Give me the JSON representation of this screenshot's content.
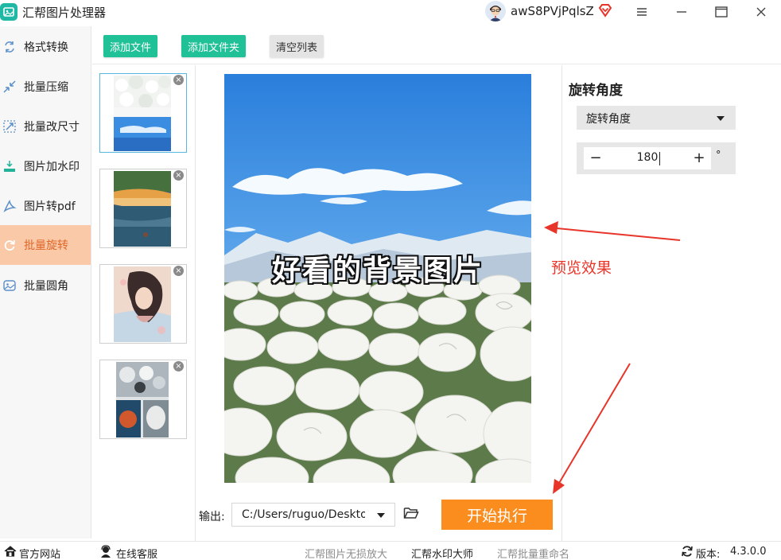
{
  "app": {
    "title": "汇帮图片处理器"
  },
  "user": {
    "name": "awS8PVjPqlsZ"
  },
  "sidebar": {
    "items": [
      {
        "label": "格式转换",
        "icon": "format-convert-icon",
        "active": false
      },
      {
        "label": "批量压缩",
        "icon": "compress-icon",
        "active": false
      },
      {
        "label": "批量改尺寸",
        "icon": "resize-icon",
        "active": false
      },
      {
        "label": "图片加水印",
        "icon": "watermark-icon",
        "active": false
      },
      {
        "label": "图片转pdf",
        "icon": "pdf-icon",
        "active": false
      },
      {
        "label": "批量旋转",
        "icon": "rotate-icon",
        "active": true
      },
      {
        "label": "批量圆角",
        "icon": "round-corner-icon",
        "active": false
      }
    ]
  },
  "toolbar": {
    "add_file": "添加文件",
    "add_folder": "添加文件夹",
    "clear_list": "清空列表"
  },
  "thumbnails": [
    {
      "selected": true
    },
    {
      "selected": false
    },
    {
      "selected": false
    },
    {
      "selected": false
    }
  ],
  "preview": {
    "caption": "好看的背景图片"
  },
  "annotation": {
    "label": "预览效果"
  },
  "rotate_panel": {
    "title": "旋转角度",
    "select_value": "旋转角度",
    "angle_value": "180",
    "minus": "−",
    "plus": "+",
    "unit": "°"
  },
  "output": {
    "label": "输出:",
    "path": "C:/Users/ruguo/Desktop"
  },
  "start_button": "开始执行",
  "footer": {
    "official_site": "官方网站",
    "online_service": "在线客服",
    "link1": "汇帮图片无损放大",
    "link2": "汇帮水印大师",
    "link3": "汇帮批量重命名",
    "version_label": "版本:",
    "version": "4.3.0.0"
  },
  "colors": {
    "accent_orange": "#fb8c1e",
    "button_green": "#20c197",
    "active_bg": "#f9c9a8",
    "active_text": "#e0682a",
    "annotation_red": "#e8352a"
  }
}
